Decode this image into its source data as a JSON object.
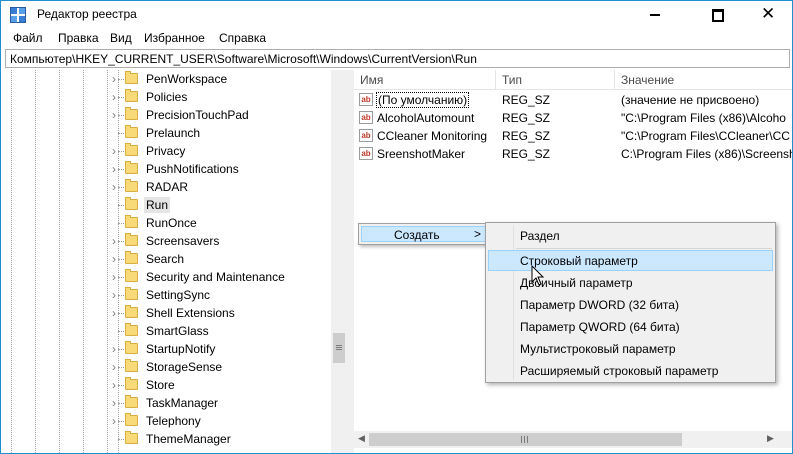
{
  "window": {
    "title": "Редактор реестра",
    "controls": {
      "minimize": "—",
      "maximize": "□",
      "close": "✕"
    }
  },
  "menubar": [
    "Файл",
    "Правка",
    "Вид",
    "Избранное",
    "Справка"
  ],
  "address": "Компьютер\\HKEY_CURRENT_USER\\Software\\Microsoft\\Windows\\CurrentVersion\\Run",
  "tree": {
    "items": [
      "PenWorkspace",
      "Policies",
      "PrecisionTouchPad",
      "Prelaunch",
      "Privacy",
      "PushNotifications",
      "RADAR",
      "Run",
      "RunOnce",
      "Screensavers",
      "Search",
      "Security and Maintenance",
      "SettingSync",
      "Shell Extensions",
      "SmartGlass",
      "StartupNotify",
      "StorageSense",
      "Store",
      "TaskManager",
      "Telephony",
      "ThemeManager"
    ],
    "selected": "Run"
  },
  "list": {
    "headers": {
      "name": "Имя",
      "type": "Тип",
      "value": "Значение"
    },
    "rows": [
      {
        "name": "(По умолчанию)",
        "type": "REG_SZ",
        "value": "(значение не присвоено)"
      },
      {
        "name": "AlcoholAutomount",
        "type": "REG_SZ",
        "value": "\"C:\\Program Files (x86)\\Alcoho"
      },
      {
        "name": "CCleaner Monitoring",
        "type": "REG_SZ",
        "value": "\"C:\\Program Files\\CCleaner\\CC"
      },
      {
        "name": "SreenshotMaker",
        "type": "REG_SZ",
        "value": "C:\\Program Files (x86)\\Screensh"
      }
    ],
    "value_icon_text": "ab"
  },
  "context_menu": {
    "create_label": "Создать",
    "arrow": ">",
    "submenu": [
      "Раздел",
      "Строковый параметр",
      "Двоичный параметр",
      "Параметр DWORD (32 бита)",
      "Параметр QWORD (64 бита)",
      "Мультистроковый параметр",
      "Расширяемый строковый параметр"
    ],
    "highlighted": "Строковый параметр"
  },
  "colors": {
    "accent_border": "#1e90cf",
    "menu_highlight": "#cce8ff",
    "folder": "#f9da78",
    "selection": "#e5e5e5"
  }
}
